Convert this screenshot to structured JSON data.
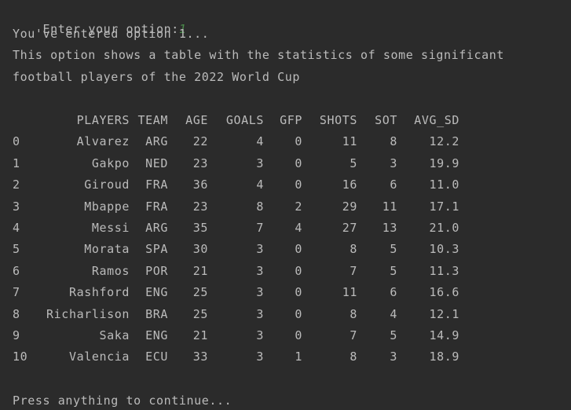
{
  "prompt": {
    "label": "Enter your option:",
    "input_value": "1"
  },
  "messages": [
    "You've entered option 1...",
    "This option shows a table with the statistics of some significant",
    "football players of the 2022 World Cup"
  ],
  "table": {
    "columns": [
      "PLAYERS",
      "TEAM",
      "AGE",
      "GOALS",
      "GFP",
      "SHOTS",
      "SOT",
      "AVG_SD"
    ],
    "rows": [
      {
        "index": "0",
        "cells": [
          "Alvarez",
          "ARG",
          "22",
          "4",
          "0",
          "11",
          "8",
          "12.2"
        ]
      },
      {
        "index": "1",
        "cells": [
          "Gakpo",
          "NED",
          "23",
          "3",
          "0",
          "5",
          "3",
          "19.9"
        ]
      },
      {
        "index": "2",
        "cells": [
          "Giroud",
          "FRA",
          "36",
          "4",
          "0",
          "16",
          "6",
          "11.0"
        ]
      },
      {
        "index": "3",
        "cells": [
          "Mbappe",
          "FRA",
          "23",
          "8",
          "2",
          "29",
          "11",
          "17.1"
        ]
      },
      {
        "index": "4",
        "cells": [
          "Messi",
          "ARG",
          "35",
          "7",
          "4",
          "27",
          "13",
          "21.0"
        ]
      },
      {
        "index": "5",
        "cells": [
          "Morata",
          "SPA",
          "30",
          "3",
          "0",
          "8",
          "5",
          "10.3"
        ]
      },
      {
        "index": "6",
        "cells": [
          "Ramos",
          "POR",
          "21",
          "3",
          "0",
          "7",
          "5",
          "11.3"
        ]
      },
      {
        "index": "7",
        "cells": [
          "Rashford",
          "ENG",
          "25",
          "3",
          "0",
          "11",
          "6",
          "16.6"
        ]
      },
      {
        "index": "8",
        "cells": [
          "Richarlison",
          "BRA",
          "25",
          "3",
          "0",
          "8",
          "4",
          "12.1"
        ]
      },
      {
        "index": "9",
        "cells": [
          "Saka",
          "ENG",
          "21",
          "3",
          "0",
          "7",
          "5",
          "14.9"
        ]
      },
      {
        "index": "10",
        "cells": [
          "Valencia",
          "ECU",
          "33",
          "3",
          "1",
          "8",
          "3",
          "18.9"
        ]
      }
    ]
  },
  "footer": {
    "continue_text": "Press anything to continue..."
  },
  "colors": {
    "background": "#2b2b2b",
    "text": "#bbbbbb",
    "input": "#4a8a4a"
  }
}
